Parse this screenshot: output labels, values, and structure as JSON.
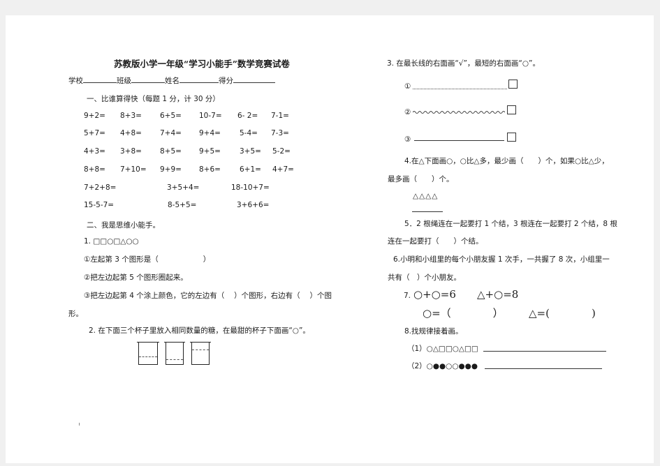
{
  "left": {
    "title": "苏教版小学一年级“学习小能手”数学竞赛试卷",
    "info": [
      "学校",
      "班级",
      "姓名",
      "得分"
    ],
    "sec1": "一、比谁算得快（每题 1 分，计 30 分）",
    "calc_rows": [
      [
        "9+2=",
        "8+3=",
        "6+5=",
        "10-7=",
        "6- 2=",
        "7-1="
      ],
      [
        "5+7=",
        "4+8=",
        "7+4=",
        "9+4=",
        "5-4=",
        "7-3="
      ],
      [
        "4+3=",
        "3+8=",
        "8+5=",
        "9+5=",
        "3+5=",
        "5-2="
      ],
      [
        "8+8=",
        "7+10=",
        "9+9=",
        "8+6=",
        "6+1=",
        "4+7="
      ]
    ],
    "calc_row5": [
      "7+2+8=",
      "3+5+4=",
      "18-10+7="
    ],
    "calc_row6": [
      "15-5-7=",
      "8-5+5=",
      "3+6+6="
    ],
    "sec2": "二、我是思维小能手。",
    "q1": "1. □□○□△○○",
    "q1a": "①左起第 3 个图形是（",
    "q1a_end": "）",
    "q1b": "②把左边起第 5 个图形圈起来。",
    "q1c": "③把左边起第 4 个涂上颜色，它的左边有（　 ）个图形，右边有（　 ）个图",
    "q1c_cont": "形。",
    "q2": "2. 在下面三个杯子里放入相同数量的糖，在最甜的杯子下面画“○”。"
  },
  "right": {
    "q3": "3. 在最长线的右面画“√”，最短的右面画“○”。",
    "line1": "①",
    "line2": "②",
    "line3": "③",
    "q4a": "4.在△下面画○，○比△多，最少画（　　）个，如果○比△少，",
    "q4b": "最多画（　　）个。",
    "triangles": "△△△△",
    "q5a": "5．2 根绳连在一起要打 1 个结，3 根连在一起要打 2 个结，8 根",
    "q5b": "连在一起要打（　　）个结。",
    "q6a": "6.小明和小组里的每个小朋友握 1 次手，一共握了 8 次，小组里一",
    "q6b": "共有（　）个小朋友。",
    "q7_num": "7.",
    "q7_eq1": "○+○=6",
    "q7_eq2": "△+○=8",
    "q7_ans1": "○=（　　　　）",
    "q7_ans2": "△=(　　　　)",
    "q8": "8.找规律接着画。",
    "q8_1": "（1）○△□□○△□□",
    "q8_2": "（2）○●●○○●●●"
  }
}
